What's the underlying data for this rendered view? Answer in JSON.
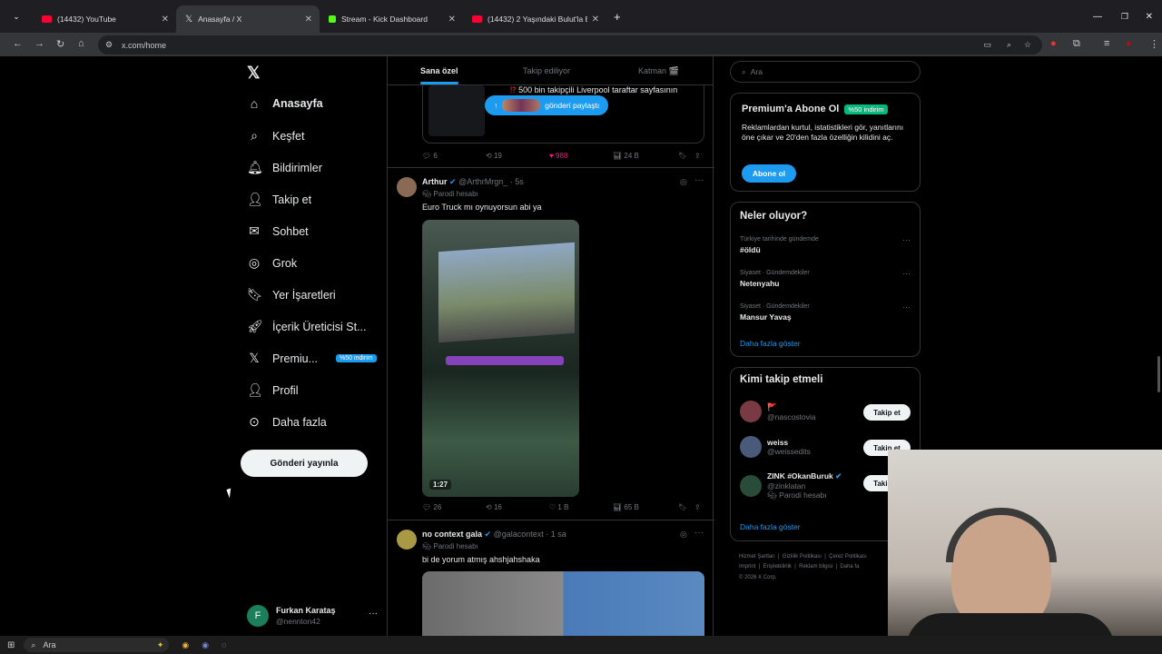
{
  "browser": {
    "tabs": [
      {
        "title": "(14432) YouTube",
        "color": "#ff0033"
      },
      {
        "title": "Anasayfa / X",
        "color": "#ffffff"
      },
      {
        "title": "Stream - Kick Dashboard",
        "color": "#53fc18"
      },
      {
        "title": "(14432) 2 Yaşındaki Bulut'la Bir",
        "color": "#ff0033"
      }
    ],
    "url": "x.com/home"
  },
  "nav": {
    "items": [
      "Anasayfa",
      "Keşfet",
      "Bildirimler",
      "Takip et",
      "Sohbet",
      "Grok",
      "Yer İşaretleri",
      "İçerik Üreticisi St...",
      "Premiu...",
      "Profil",
      "Daha fazla"
    ],
    "premium_badge": "%50 indirim",
    "post_button": "Gönderi yayınla",
    "user_name": "Furkan Karataş",
    "user_handle": "@nennton42",
    "user_initial": "F"
  },
  "feed": {
    "tabs": [
      "Sana özel",
      "Takip ediliyor",
      "Katman 🎬"
    ],
    "top_post": {
      "text": "500 bin takipçili Liverpool taraftar sayfasının",
      "share_label": "gönderi paylaştı",
      "replies": "6",
      "reposts": "19",
      "likes": "988",
      "views": "24 B"
    },
    "tweet1": {
      "name": "Arthur",
      "handle": "@ArthrMrgn_",
      "time": "· 5s",
      "label": "Parodi hesabı",
      "text": "Euro Truck mı oynuyorsun abi ya",
      "duration": "1:27",
      "replies": "26",
      "reposts": "16",
      "likes": "1 B",
      "views": "65 B"
    },
    "tweet2": {
      "name": "no context gala",
      "handle": "@galacontext",
      "time": "· 1 sa",
      "label": "Parodi hesabı",
      "text": "bi de yorum atmış ahshjahshaka"
    }
  },
  "sidebar": {
    "search_placeholder": "Ara",
    "premium": {
      "title": "Premium'a Abone Ol",
      "badge": "%50 indirim",
      "text": "Reklamlardan kurtul, istatistikleri gör, yanıtlarını öne çıkar ve 20'den fazla özelliğin kilidini aç.",
      "button": "Abone ol"
    },
    "trends": {
      "title": "Neler oluyor?",
      "items": [
        {
          "context": "Türkiye tarihinde gündemde",
          "name": "#öldü"
        },
        {
          "context": "Siyaset · Gündemdekiler",
          "name": "Netenyahu"
        },
        {
          "context": "Siyaset · Gündemdekiler",
          "name": "Mansur Yavaş"
        }
      ],
      "more": "Daha fazla göster"
    },
    "who_to_follow": {
      "title": "Kimi takip etmeli",
      "items": [
        {
          "name": "🚩",
          "handle": "@nascostovia",
          "button": "Takip et"
        },
        {
          "name": "weiss",
          "handle": "@weissedits",
          "button": "Takip et"
        },
        {
          "name": "ZINK #OkanBuruk",
          "handle": "@zinklatan",
          "sub": "Parodi hesabı",
          "button": "Takip et"
        }
      ],
      "more": "Daha fazla göster"
    },
    "footer": [
      "Hizmet Şartları",
      "Gizlilik Politikası",
      "Çerez Politikası",
      "Imprint",
      "Erişilebilirlik",
      "Reklam bilgisi",
      "Daha fa",
      "© 2026 X Corp."
    ]
  },
  "taskbar": {
    "search": "Ara"
  }
}
